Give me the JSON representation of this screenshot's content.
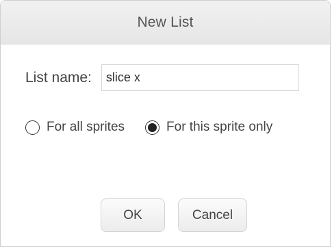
{
  "dialog": {
    "title": "New List"
  },
  "list_name": {
    "label": "List name:",
    "value": "slice x"
  },
  "scope": {
    "options": [
      {
        "label": "For all sprites",
        "selected": false
      },
      {
        "label": "For this sprite only",
        "selected": true
      }
    ]
  },
  "buttons": {
    "ok_label": "OK",
    "cancel_label": "Cancel"
  }
}
